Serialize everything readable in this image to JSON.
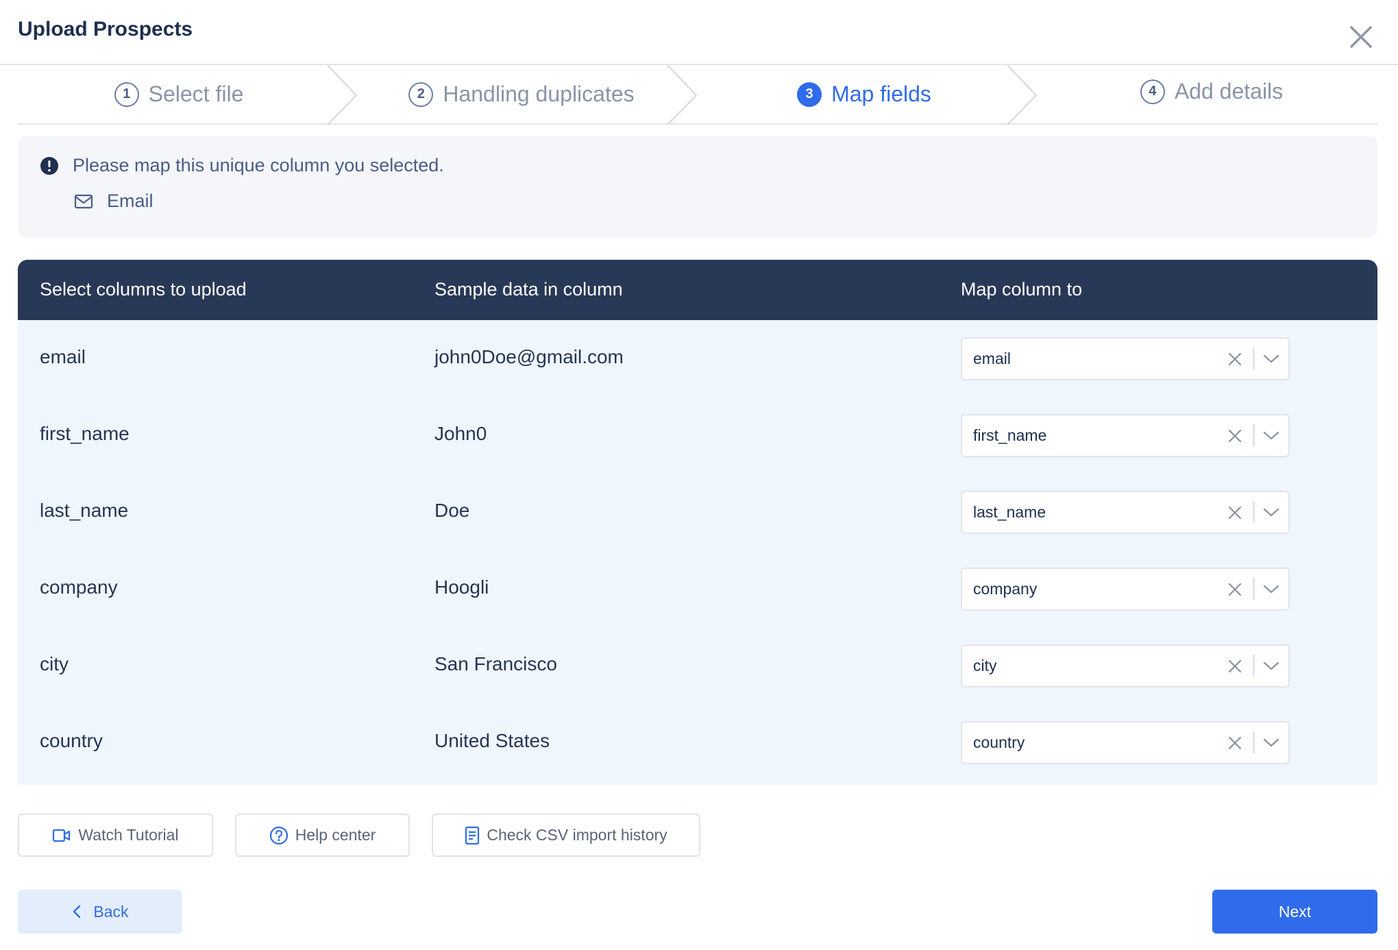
{
  "header": {
    "title": "Upload Prospects",
    "close_icon": "close-icon"
  },
  "stepper": {
    "steps": [
      {
        "number": "1",
        "label": "Select file",
        "state": "done"
      },
      {
        "number": "2",
        "label": "Handling duplicates",
        "state": "done"
      },
      {
        "number": "3",
        "label": "Map fields",
        "state": "active"
      },
      {
        "number": "4",
        "label": "Add details",
        "state": "upcoming"
      }
    ]
  },
  "info": {
    "message": "Please map this unique column you selected.",
    "unique_column": "Email",
    "icons": {
      "alert": "exclamation-circle-icon",
      "field": "mail-icon"
    }
  },
  "table": {
    "headers": [
      "Select columns to upload",
      "Sample data in column",
      "Map column to"
    ],
    "rows": [
      {
        "column": "email",
        "sample": "john0Doe@gmail.com",
        "mapped_to": "email"
      },
      {
        "column": "first_name",
        "sample": "John0",
        "mapped_to": "first_name"
      },
      {
        "column": "last_name",
        "sample": "Doe",
        "mapped_to": "last_name"
      },
      {
        "column": "company",
        "sample": "Hoogli",
        "mapped_to": "company"
      },
      {
        "column": "city",
        "sample": "San Francisco",
        "mapped_to": "city"
      },
      {
        "column": "country",
        "sample": "United States",
        "mapped_to": "country"
      }
    ]
  },
  "help_buttons": {
    "watch_tutorial": "Watch Tutorial",
    "help_center": "Help center",
    "csv_history": "Check CSV import history"
  },
  "footer": {
    "back": "Back",
    "next": "Next"
  },
  "colors": {
    "accent": "#2f6bea",
    "header_bg": "#283957",
    "row_bg": "#f0f6fd",
    "info_bg": "#f4f6fa"
  }
}
